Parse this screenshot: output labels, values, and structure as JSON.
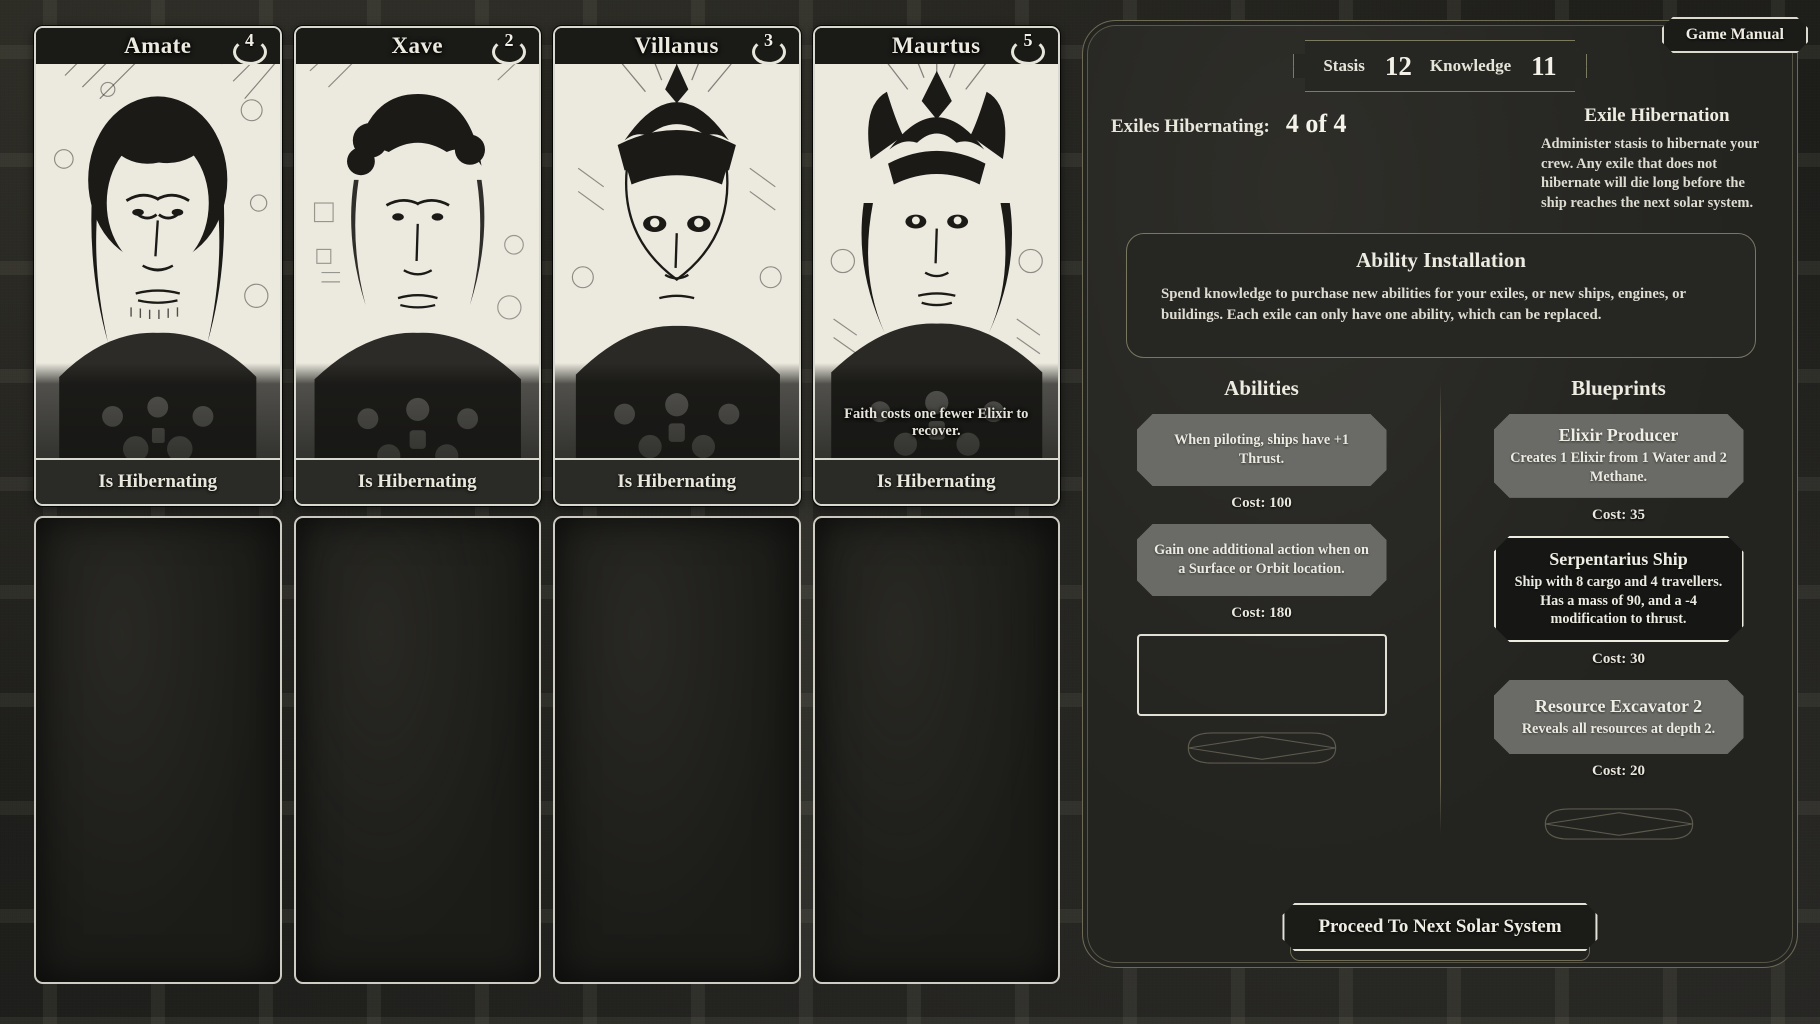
{
  "header": {
    "game_manual_label": "Game Manual"
  },
  "stats": {
    "stasis_label": "Stasis",
    "stasis_value": "12",
    "knowledge_label": "Knowledge",
    "knowledge_value": "11"
  },
  "hibernation": {
    "counter_label": "Exiles Hibernating:",
    "counter_value": "4 of 4",
    "info_title": "Exile Hibernation",
    "info_text": "Administer stasis to hibernate your crew. Any exile that does not hibernate will die long before the ship reaches the next solar system."
  },
  "ability_installation": {
    "title": "Ability Installation",
    "text": "Spend knowledge to purchase new abilities for your exiles, or new ships, engines, or buildings. Each exile can only have one ability, which can be replaced."
  },
  "exiles": [
    {
      "name": "Amate",
      "badge": "4",
      "status": "Is Hibernating",
      "ability_note": "",
      "portrait": "long-dark-hair-exile-portrait"
    },
    {
      "name": "Xave",
      "badge": "2",
      "status": "Is Hibernating",
      "ability_note": "",
      "portrait": "curly-hair-exile-portrait"
    },
    {
      "name": "Villanus",
      "badge": "3",
      "status": "Is Hibernating",
      "ability_note": "",
      "portrait": "helmeted-exile-portrait"
    },
    {
      "name": "Maurtus",
      "badge": "5",
      "status": "Is Hibernating",
      "ability_note": "Faith costs one fewer Elixir to recover.",
      "portrait": "crowned-exile-portrait"
    }
  ],
  "empty_slots": [
    {
      "label": ""
    },
    {
      "label": ""
    },
    {
      "label": ""
    },
    {
      "label": ""
    }
  ],
  "abilities": {
    "heading": "Abilities",
    "items": [
      {
        "title": "",
        "description": "When piloting, ships have +1 Thrust.",
        "cost_label": "Cost: 100",
        "state": "available"
      },
      {
        "title": "",
        "description": "Gain one additional action when on a Surface or Orbit location.",
        "cost_label": "Cost: 180",
        "state": "available"
      },
      {
        "title": "",
        "description": "",
        "cost_label": "",
        "state": "empty"
      }
    ]
  },
  "blueprints": {
    "heading": "Blueprints",
    "items": [
      {
        "title": "Elixir Producer",
        "description": "Creates 1 Elixir from 1 Water and 2 Methane.",
        "cost_label": "Cost: 35",
        "state": "available"
      },
      {
        "title": "Serpentarius Ship",
        "description": "Ship with 8 cargo and 4 travellers. Has a mass of 90, and a -4 modification to thrust.",
        "cost_label": "Cost: 30",
        "state": "selected"
      },
      {
        "title": "Resource Excavator 2",
        "description": "Reveals all resources at depth 2.",
        "cost_label": "Cost: 20",
        "state": "available"
      }
    ]
  },
  "footer": {
    "proceed_label": "Proceed To Next Solar System"
  },
  "colors": {
    "background": "#232320",
    "card_border": "#d9d8ce",
    "panel_border": "#6d6a55",
    "text_primary": "#eeece1",
    "buy_card_bg": "#6a6a66",
    "portrait_paper": "#eceadf"
  }
}
